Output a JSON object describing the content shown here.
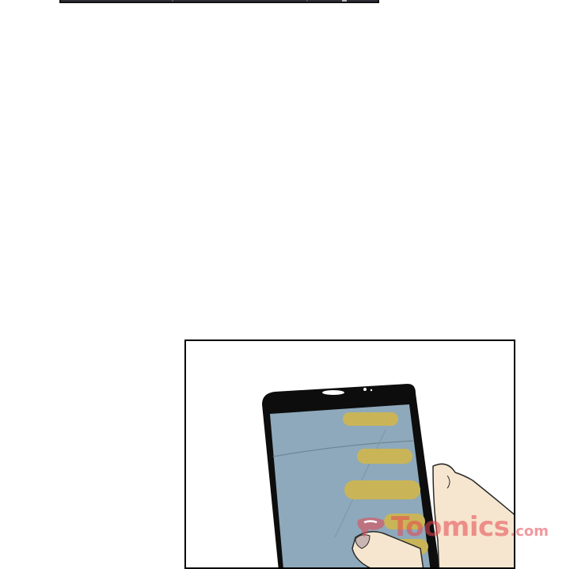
{
  "watermark": {
    "brand": "Toomics",
    "suffix": ".com",
    "logo_icon": "toomics-logo-icon"
  },
  "panels": [
    {
      "name": "top-comic-panel",
      "content": "dark-scene-cropped"
    },
    {
      "name": "phone-comic-panel",
      "content": "hand-holding-smartphone-with-message-bubbles"
    }
  ],
  "colors": {
    "panel_border": "#000000",
    "phone_screen": "#8ea9bb",
    "message_bubble": "#c9b558",
    "skin": "#f6e6cf",
    "watermark": "#e64650"
  }
}
